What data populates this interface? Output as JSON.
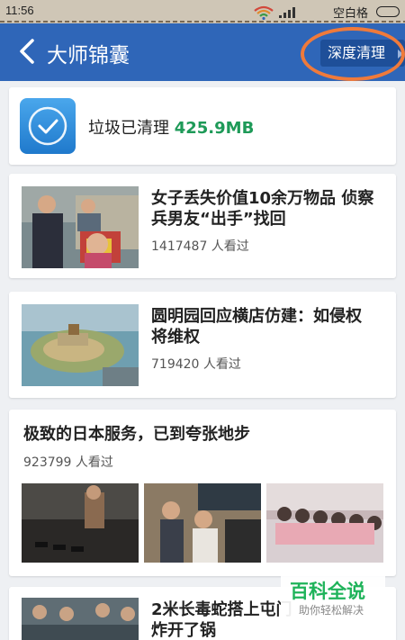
{
  "status_bar": {
    "time": "11:56",
    "carrier": "空白格"
  },
  "header": {
    "title": "大师锦囊",
    "deep_clean_label": "深度清理"
  },
  "clean_card": {
    "label": "垃圾已清理",
    "size": "425.9MB"
  },
  "news": [
    {
      "title_line1": "女子丢失价值10余万物品 侦察",
      "title_line2": "兵男友“出手”找回",
      "views": "1417487 人看过"
    },
    {
      "title_line1": "圆明园回应横店仿建：如侵权",
      "title_line2": "将维权",
      "views": "719420 人看过"
    },
    {
      "title": "极致的日本服务，已到夸张地步",
      "views": "923799 人看过"
    },
    {
      "title_line1": "2米长毒蛇搭上屯门",
      "title_line2": "炸开了锅"
    }
  ],
  "watermark": {
    "title": "百科全说",
    "subtitle": "助你轻松解决"
  },
  "colors": {
    "header_bg": "#2f66b8",
    "accent_green": "#1e9a58",
    "highlight_ring": "#ef7a3b"
  }
}
